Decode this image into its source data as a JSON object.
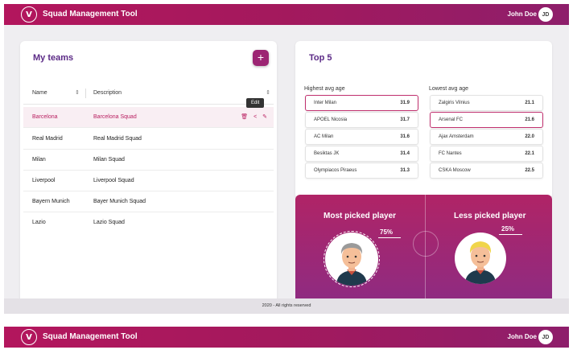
{
  "header": {
    "logo_text": "V",
    "title": "Squad Management Tool",
    "user_name": "John Doe",
    "user_initials": "JD"
  },
  "teams": {
    "title": "My teams",
    "add_label": "+",
    "columns": {
      "name": "Name",
      "description": "Description"
    },
    "sort_icon": "⇕",
    "tooltip": "Edit",
    "rows": [
      {
        "name": "Barcelona",
        "description": "Barcelona Squad"
      },
      {
        "name": "Real Madrid",
        "description": "Real Madrid Squad"
      },
      {
        "name": "Milan",
        "description": "Milan Squad"
      },
      {
        "name": "Liverpool",
        "description": "Liverpool Squad"
      },
      {
        "name": "Bayern Munich",
        "description": "Bayer Munich Squad"
      },
      {
        "name": "Lazio",
        "description": "Lazio Squad"
      }
    ],
    "actions": {
      "delete": "🗑",
      "share": "<",
      "edit": "✎"
    }
  },
  "top5": {
    "title": "Top 5",
    "highest_label": "Highest avg age",
    "lowest_label": "Lowest avg age",
    "highest": [
      {
        "team": "Inter Milan",
        "age": "31.9"
      },
      {
        "team": "APOEL Nicosia",
        "age": "31.7"
      },
      {
        "team": "AC Milan",
        "age": "31.6"
      },
      {
        "team": "Besiktas JK",
        "age": "31.4"
      },
      {
        "team": "Olympiacos Piraeus",
        "age": "31.3"
      }
    ],
    "lowest": [
      {
        "team": "Zalgiris Vilnius",
        "age": "21.1"
      },
      {
        "team": "Arsenal FC",
        "age": "21.6"
      },
      {
        "team": "Ajax Amsterdam",
        "age": "22.0"
      },
      {
        "team": "FC Nantes",
        "age": "22.1"
      },
      {
        "team": "CSKA Moscow",
        "age": "22.5"
      }
    ]
  },
  "picked": {
    "most_title": "Most picked player",
    "most_pct": "75%",
    "less_title": "Less picked player",
    "less_pct": "25%"
  },
  "footer": {
    "text": "2020 - All rights reserved"
  },
  "colors": {
    "primary": "#b3165d",
    "accent": "#5b2a86",
    "selected": "#b81d5f"
  }
}
